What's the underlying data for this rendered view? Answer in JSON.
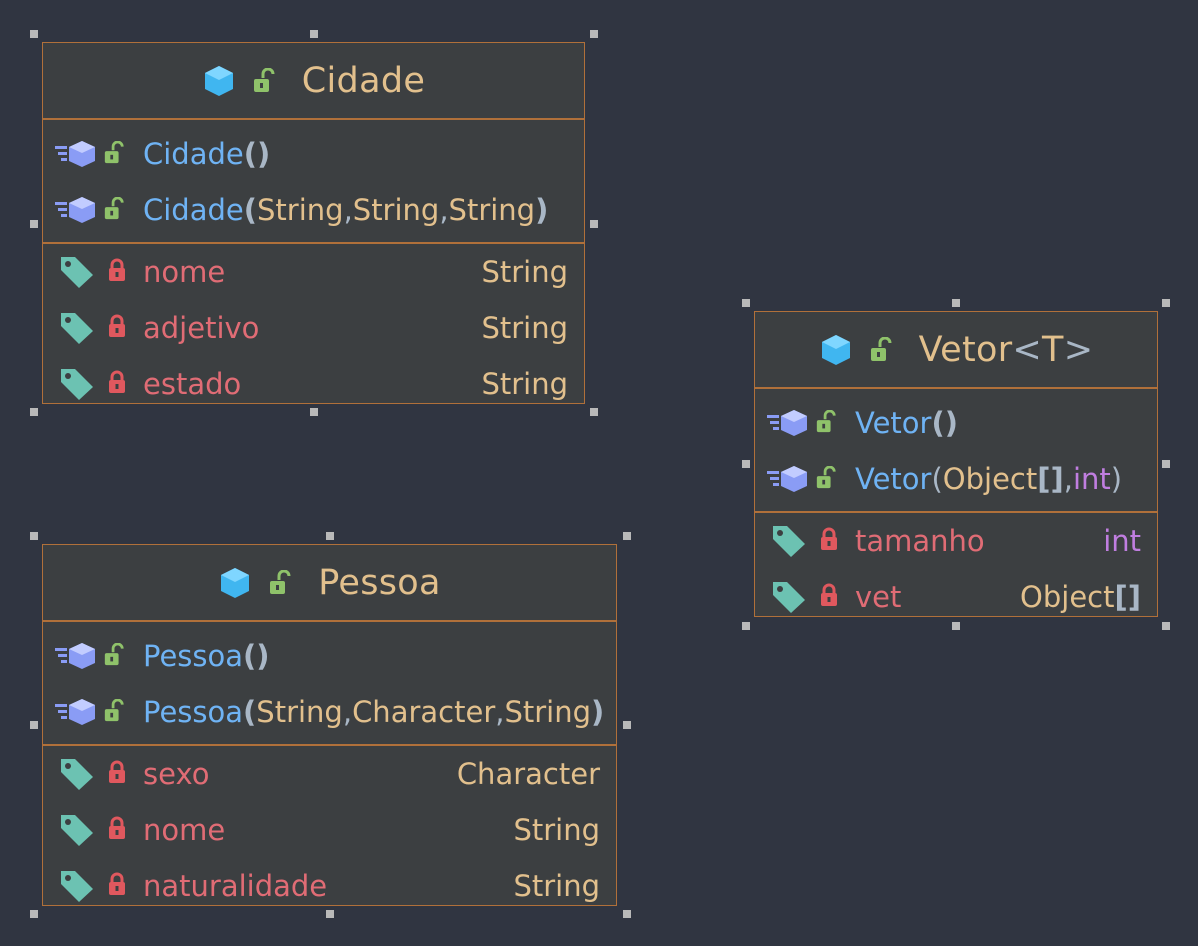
{
  "classes": {
    "cidade": {
      "name": "Cidade",
      "constructors": [
        {
          "name": "Cidade",
          "params": []
        },
        {
          "name": "Cidade",
          "params": [
            "String",
            "String",
            "String"
          ]
        }
      ],
      "fields": [
        {
          "name": "nome",
          "type": "String"
        },
        {
          "name": "adjetivo",
          "type": "String"
        },
        {
          "name": "estado",
          "type": "String"
        }
      ]
    },
    "pessoa": {
      "name": "Pessoa",
      "constructors": [
        {
          "name": "Pessoa",
          "params": []
        },
        {
          "name": "Pessoa",
          "params": [
            "String",
            "Character",
            "String"
          ]
        }
      ],
      "fields": [
        {
          "name": "sexo",
          "type": "Character"
        },
        {
          "name": "nome",
          "type": "String"
        },
        {
          "name": "naturalidade",
          "type": "String"
        }
      ]
    },
    "vetor": {
      "name": "Vetor",
      "type_param": "T",
      "constructors": [
        {
          "name": "Vetor",
          "params": []
        },
        {
          "name": "Vetor",
          "params": [
            "Object",
            "int"
          ]
        }
      ],
      "fields": [
        {
          "name": "tamanho",
          "type": "int"
        },
        {
          "name": "vet",
          "type": "Object"
        }
      ]
    }
  },
  "icons": {
    "class": "class-icon",
    "public": "unlocked-icon",
    "constructor": "constructor-icon",
    "field": "field-tag-icon",
    "private": "locked-icon"
  },
  "colors": {
    "background": "#303541",
    "box": "#3c3f41",
    "border": "#b0703a",
    "class_name": "#e2c08d",
    "method": "#6fb3f4",
    "field": "#e06c75",
    "keyword": "#c07ee0"
  }
}
